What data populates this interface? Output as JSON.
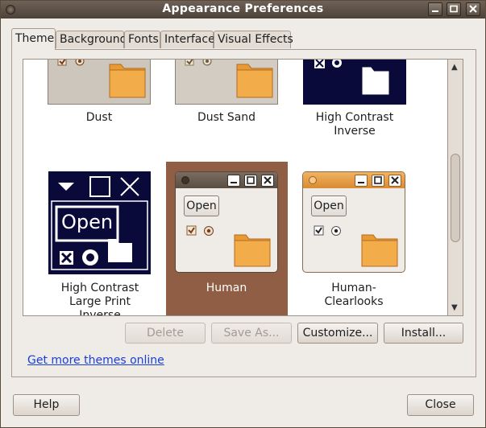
{
  "window": {
    "title": "Appearance Preferences"
  },
  "tabs": [
    {
      "label": "Theme"
    },
    {
      "label": "Background"
    },
    {
      "label": "Fonts"
    },
    {
      "label": "Interface"
    },
    {
      "label": "Visual Effects"
    }
  ],
  "themes": [
    {
      "name": "Dust",
      "selected": false
    },
    {
      "name": "Dust Sand",
      "selected": false
    },
    {
      "name": "High Contrast Inverse",
      "selected": false
    },
    {
      "name": "High Contrast Large Print Inverse",
      "selected": false,
      "preview_open": "Open"
    },
    {
      "name": "Human",
      "selected": true,
      "preview_open": "Open"
    },
    {
      "name": "Human-Clearlooks",
      "selected": false,
      "preview_open": "Open"
    }
  ],
  "actions": {
    "delete": "Delete",
    "save_as": "Save As...",
    "customize": "Customize...",
    "install": "Install..."
  },
  "more_themes_link": "Get more themes online",
  "footer": {
    "help": "Help",
    "close": "Close"
  },
  "colors": {
    "titlebar": "#5c5046",
    "selection": "#8f5e45",
    "link": "#1a3fd6",
    "high_contrast_bg": "#0a0a3a",
    "human_accent": "#d98a32"
  }
}
